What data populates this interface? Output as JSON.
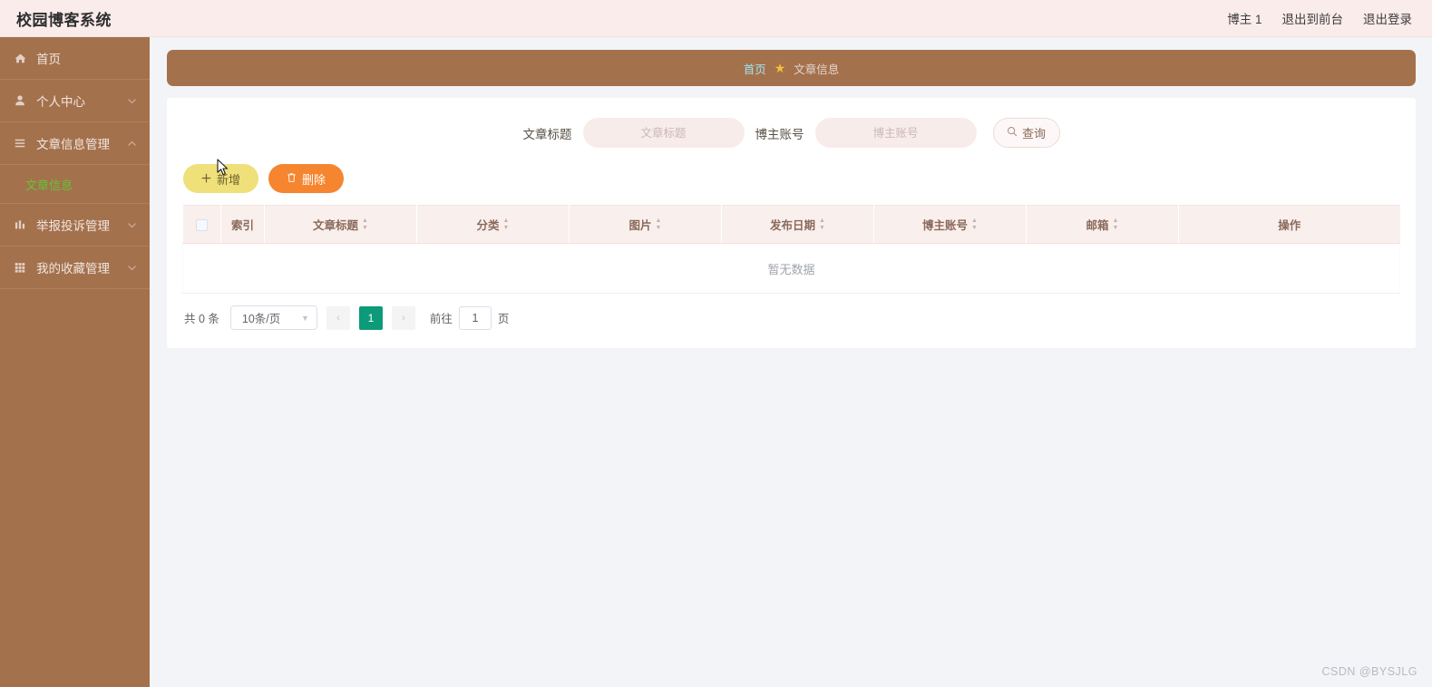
{
  "header": {
    "title": "校园博客系统",
    "links": [
      {
        "label": "博主 1",
        "name": "user-name"
      },
      {
        "label": "退出到前台",
        "name": "exit-to-front"
      },
      {
        "label": "退出登录",
        "name": "logout"
      }
    ]
  },
  "sidebar": {
    "items": [
      {
        "label": "首页",
        "icon": "home-icon",
        "expandable": false
      },
      {
        "label": "个人中心",
        "icon": "user-icon",
        "expandable": true,
        "expanded": false
      },
      {
        "label": "文章信息管理",
        "icon": "list-icon",
        "expandable": true,
        "expanded": true,
        "children": [
          {
            "label": "文章信息",
            "active": true
          }
        ]
      },
      {
        "label": "举报投诉管理",
        "icon": "chart-icon",
        "expandable": true,
        "expanded": false
      },
      {
        "label": "我的收藏管理",
        "icon": "grid-icon",
        "expandable": true,
        "expanded": false
      }
    ]
  },
  "breadcrumb": {
    "home": "首页",
    "star": "★",
    "current": "文章信息"
  },
  "search": {
    "title_label": "文章标题",
    "title_value": "",
    "title_placeholder": "文章标题",
    "account_label": "博主账号",
    "account_value": "",
    "account_placeholder": "博主账号",
    "query_label": "查询"
  },
  "actions": {
    "add_label": "新增",
    "add_icon": "plus-icon",
    "delete_label": "删除",
    "delete_icon": "trash-icon"
  },
  "table": {
    "columns": [
      {
        "label": "",
        "name": "select-all",
        "sortable": false
      },
      {
        "label": "索引",
        "name": "index",
        "sortable": false
      },
      {
        "label": "文章标题",
        "name": "article-title",
        "sortable": true
      },
      {
        "label": "分类",
        "name": "category",
        "sortable": true
      },
      {
        "label": "图片",
        "name": "image",
        "sortable": true
      },
      {
        "label": "发布日期",
        "name": "publish-date",
        "sortable": true
      },
      {
        "label": "博主账号",
        "name": "blogger-account",
        "sortable": true
      },
      {
        "label": "邮箱",
        "name": "email",
        "sortable": true
      },
      {
        "label": "操作",
        "name": "operation",
        "sortable": false
      }
    ],
    "rows": [],
    "empty_text": "暂无数据"
  },
  "pagination": {
    "total_text": "共 0 条",
    "page_size": "10条/页",
    "prev": "‹",
    "next": "›",
    "current_page": "1",
    "goto_label": "前往",
    "goto_value": "1",
    "page_unit": "页"
  },
  "watermark": "CSDN @BYSJLG",
  "colors": {
    "brand_brown": "#a4714d",
    "header_pink": "#faeceb",
    "active_green": "#66c234",
    "add_yellow": "#efe07a",
    "delete_orange": "#f5852f",
    "page_active_teal": "#0d9a78",
    "star_yellow": "#f2c03c",
    "crumb_home_blue": "#9fe3ef"
  }
}
